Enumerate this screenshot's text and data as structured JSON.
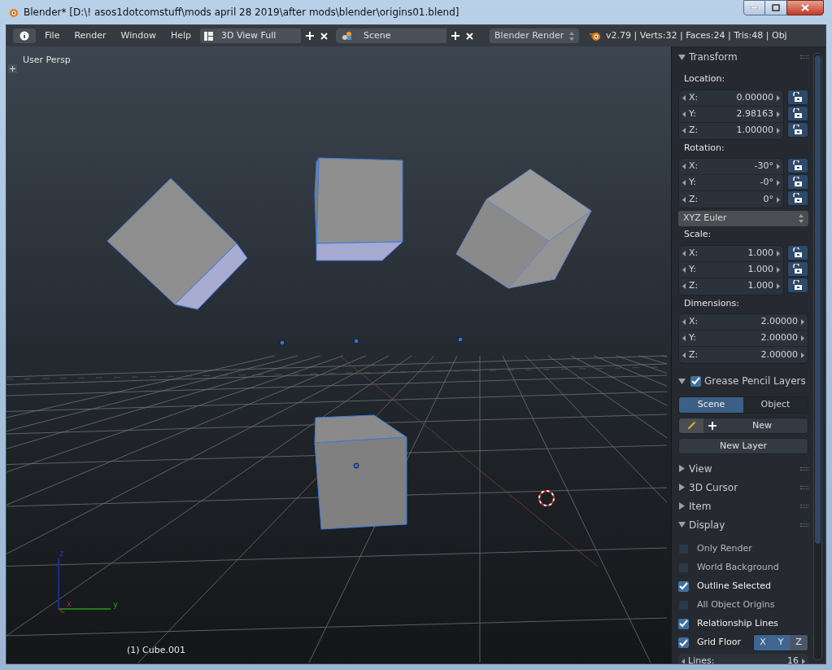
{
  "window": {
    "title": "Blender* [D:\\! asos1dotcomstuff\\mods april 28 2019\\after mods\\blender\\origins01.blend]"
  },
  "header": {
    "menus": [
      "File",
      "Render",
      "Window",
      "Help"
    ],
    "screen_layout": "3D View Full",
    "scene": "Scene",
    "render_engine": "Blender Render",
    "stats": "v2.79 | Verts:32 | Faces:24 | Tris:48 | Obj"
  },
  "viewport": {
    "view_label": "User Persp",
    "object_label": "(1) Cube.001",
    "axes": [
      "x",
      "y",
      "z"
    ]
  },
  "sidebar": {
    "transform": {
      "title": "Transform",
      "expanded": true,
      "location": {
        "label": "Location:",
        "fields": [
          {
            "axis": "X:",
            "value": "0.00000",
            "locked": false
          },
          {
            "axis": "Y:",
            "value": "2.98163",
            "locked": false
          },
          {
            "axis": "Z:",
            "value": "1.00000",
            "locked": false
          }
        ]
      },
      "rotation": {
        "label": "Rotation:",
        "fields": [
          {
            "axis": "X:",
            "value": "-30°",
            "locked": false
          },
          {
            "axis": "Y:",
            "value": "-0°",
            "locked": false
          },
          {
            "axis": "Z:",
            "value": "0°",
            "locked": false
          }
        ]
      },
      "rotation_mode": "XYZ Euler",
      "scale": {
        "label": "Scale:",
        "fields": [
          {
            "axis": "X:",
            "value": "1.000",
            "locked": false
          },
          {
            "axis": "Y:",
            "value": "1.000",
            "locked": false
          },
          {
            "axis": "Z:",
            "value": "1.000",
            "locked": false
          }
        ]
      },
      "dimensions": {
        "label": "Dimensions:",
        "fields": [
          {
            "axis": "X:",
            "value": "2.00000"
          },
          {
            "axis": "Y:",
            "value": "2.00000"
          },
          {
            "axis": "Z:",
            "value": "2.00000"
          }
        ]
      }
    },
    "grease_pencil": {
      "title": "Grease Pencil Layers",
      "expanded": true,
      "checked": true,
      "tabs": [
        {
          "label": "Scene",
          "selected": true
        },
        {
          "label": "Object",
          "selected": false
        }
      ],
      "new_button": "New",
      "new_layer_button": "New Layer"
    },
    "panels": [
      {
        "title": "View",
        "expanded": false
      },
      {
        "title": "3D Cursor",
        "expanded": false
      },
      {
        "title": "Item",
        "expanded": false
      },
      {
        "title": "Display",
        "expanded": true
      }
    ],
    "display": {
      "options": [
        {
          "label": "Only Render",
          "checked": false
        },
        {
          "label": "World Background",
          "checked": false
        },
        {
          "label": "Outline Selected",
          "checked": true
        },
        {
          "label": "All Object Origins",
          "checked": false
        },
        {
          "label": "Relationship Lines",
          "checked": true
        },
        {
          "label": "Grid Floor",
          "checked": true
        }
      ],
      "grid_axes": [
        {
          "label": "X",
          "selected": true
        },
        {
          "label": "Y",
          "selected": true
        },
        {
          "label": "Z",
          "selected": false
        }
      ],
      "lines": {
        "label": "Lines:",
        "value": "16"
      }
    }
  }
}
